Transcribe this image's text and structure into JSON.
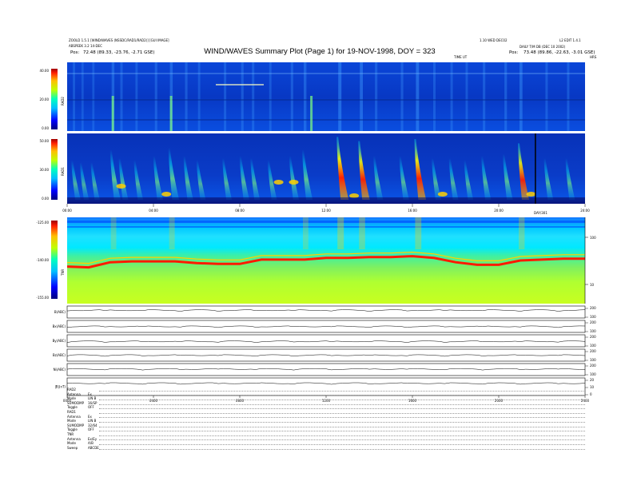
{
  "header": {
    "left1": "ZOOLD 1.5.1 [WIND/WAVES (NSSDC/RAD1/RAD2)] [GUI IMAGE]",
    "left2": "ABSPEEK 3.2 14-DEC",
    "left3_label": "Pos:",
    "left3_value": "72.48 (89.33, -23.76, -2.71 GSE)",
    "right1": "1.10 WED DEC02",
    "right2": "L2 EDIT 1.4.1",
    "right3": "DAILY T/M DB (DEC 10 2002)",
    "right4_label": "Pos:",
    "right4_value": "73.48 (89.86, -22.63, -3.01 GSE)",
    "title": "WIND/WAVES Summary Plot (Page 1) for 19-NOV-1998, DOY = 323",
    "axis_note_top": "TIME UT",
    "axis_note_hr": "HRS",
    "axis_note_tnr": "DAY/301"
  },
  "chart_data": [
    {
      "type": "heatmap",
      "panel": "RAD2",
      "ylabel": "RAD2",
      "yticks": [
        "40.00",
        "20.00",
        "0.00"
      ],
      "ylim": [
        0,
        40
      ],
      "colorscale": "jet",
      "background": "blue",
      "features": [
        {
          "x_hour": 2.1,
          "kind": "type-III burst"
        },
        {
          "x_hour": 4.8,
          "kind": "type-III burst"
        },
        {
          "x_hour": 11.3,
          "kind": "type-III burst"
        }
      ]
    },
    {
      "type": "heatmap",
      "panel": "RAD1",
      "ylabel": "RAD1",
      "yticks": [
        "50.00",
        "30.00",
        "0.00"
      ],
      "ylim": [
        0,
        50
      ],
      "colorscale": "jet",
      "xticks": [
        "00:00",
        "04:00",
        "08:00",
        "12:00",
        "16:00",
        "20:00",
        "24:00"
      ],
      "xlim_hours": [
        0,
        24
      ],
      "bursts": [
        {
          "t": 0.3,
          "i": 0.45
        },
        {
          "t": 0.7,
          "i": 0.4
        },
        {
          "t": 1.2,
          "i": 0.4
        },
        {
          "t": 2.1,
          "i": 0.7
        },
        {
          "t": 2.5,
          "i": 0.5
        },
        {
          "t": 3.2,
          "i": 0.45
        },
        {
          "t": 4.1,
          "i": 0.55
        },
        {
          "t": 4.8,
          "i": 0.75
        },
        {
          "t": 5.5,
          "i": 0.55
        },
        {
          "t": 6.1,
          "i": 0.45
        },
        {
          "t": 7.3,
          "i": 0.5
        },
        {
          "t": 8.1,
          "i": 0.55
        },
        {
          "t": 8.6,
          "i": 0.5
        },
        {
          "t": 9.4,
          "i": 0.45
        },
        {
          "t": 10.4,
          "i": 0.55
        },
        {
          "t": 11.0,
          "i": 0.7
        },
        {
          "t": 12.6,
          "i": 1.0
        },
        {
          "t": 13.6,
          "i": 0.9
        },
        {
          "t": 14.3,
          "i": 0.55
        },
        {
          "t": 15.5,
          "i": 0.55
        },
        {
          "t": 16.2,
          "i": 0.95
        },
        {
          "t": 17.0,
          "i": 0.5
        },
        {
          "t": 17.8,
          "i": 0.5
        },
        {
          "t": 18.5,
          "i": 0.45
        },
        {
          "t": 19.3,
          "i": 0.55
        },
        {
          "t": 20.3,
          "i": 0.6
        },
        {
          "t": 21.0,
          "i": 0.85
        },
        {
          "t": 22.2,
          "i": 0.5
        },
        {
          "t": 23.2,
          "i": 0.5
        }
      ]
    },
    {
      "type": "heatmap",
      "panel": "TNR",
      "ylabel": "TNR",
      "yticks": [
        "-125.00",
        "-140.00",
        "-155.00"
      ],
      "ylim": [
        -155,
        -125
      ],
      "right_ticks": [
        "100",
        "10"
      ],
      "colorscale": "jet",
      "plasma_line": [
        [
          0,
          0.57
        ],
        [
          1,
          0.58
        ],
        [
          2,
          0.52
        ],
        [
          3,
          0.51
        ],
        [
          4,
          0.51
        ],
        [
          5,
          0.51
        ],
        [
          6,
          0.53
        ],
        [
          7,
          0.54
        ],
        [
          8,
          0.54
        ],
        [
          9,
          0.49
        ],
        [
          10,
          0.49
        ],
        [
          11,
          0.49
        ],
        [
          12,
          0.47
        ],
        [
          13,
          0.47
        ],
        [
          14,
          0.46
        ],
        [
          15,
          0.46
        ],
        [
          16,
          0.45
        ],
        [
          17,
          0.47
        ],
        [
          18,
          0.52
        ],
        [
          19,
          0.55
        ],
        [
          20,
          0.55
        ],
        [
          21,
          0.5
        ],
        [
          22,
          0.49
        ],
        [
          23,
          0.48
        ],
        [
          24,
          0.48
        ]
      ]
    },
    {
      "type": "line",
      "panel": "MFI",
      "series": [
        {
          "name": "B(ABC)",
          "right_ticks": [
            "200",
            "100"
          ],
          "level": 0.35
        },
        {
          "name": "Bx(ABC)",
          "right_ticks": [
            "200",
            "100"
          ],
          "level": 0.5
        },
        {
          "name": "By(ABC)",
          "right_ticks": [
            "200",
            "100"
          ],
          "level": 0.55
        },
        {
          "name": "Bz(ABC)",
          "right_ticks": [
            "200",
            "100"
          ],
          "level": 0.5
        },
        {
          "name": "Ni(ABC)",
          "right_ticks": [
            "200",
            "100"
          ],
          "level": 0.45
        },
        {
          "name": "|B|(nT)",
          "right_ticks": [
            "20",
            "10",
            "0"
          ],
          "level": 0.3
        }
      ],
      "xticks": [
        "0000",
        "0400",
        "0800",
        "1200",
        "1600",
        "2000",
        "2400"
      ]
    }
  ],
  "footer": {
    "rows": [
      {
        "k": "RAD2",
        "v": ""
      },
      {
        "k": "Antenna",
        "v": "Ex"
      },
      {
        "k": "Mode",
        "v": "LIN B"
      },
      {
        "k": "SUMODMP",
        "v": "16/SP"
      },
      {
        "k": "Toggle",
        "v": "OFF"
      },
      {
        "k": "RAD1",
        "v": ""
      },
      {
        "k": "Antenna",
        "v": "Ex"
      },
      {
        "k": "Mode",
        "v": "LIN B"
      },
      {
        "k": "SUMODMP",
        "v": "32/64"
      },
      {
        "k": "Toggle",
        "v": "OFF"
      },
      {
        "k": "TNR",
        "v": ""
      },
      {
        "k": "Antenna",
        "v": "Ex/Ey"
      },
      {
        "k": "Mode",
        "v": "A/B"
      },
      {
        "k": "Sweep",
        "v": "ABCDE"
      }
    ]
  },
  "colors": {
    "cbar": [
      "#00007f",
      "#0000ff",
      "#007fff",
      "#00ffff",
      "#7fff7f",
      "#ffff00",
      "#ff7f00",
      "#ff0000",
      "#7f0000"
    ]
  }
}
